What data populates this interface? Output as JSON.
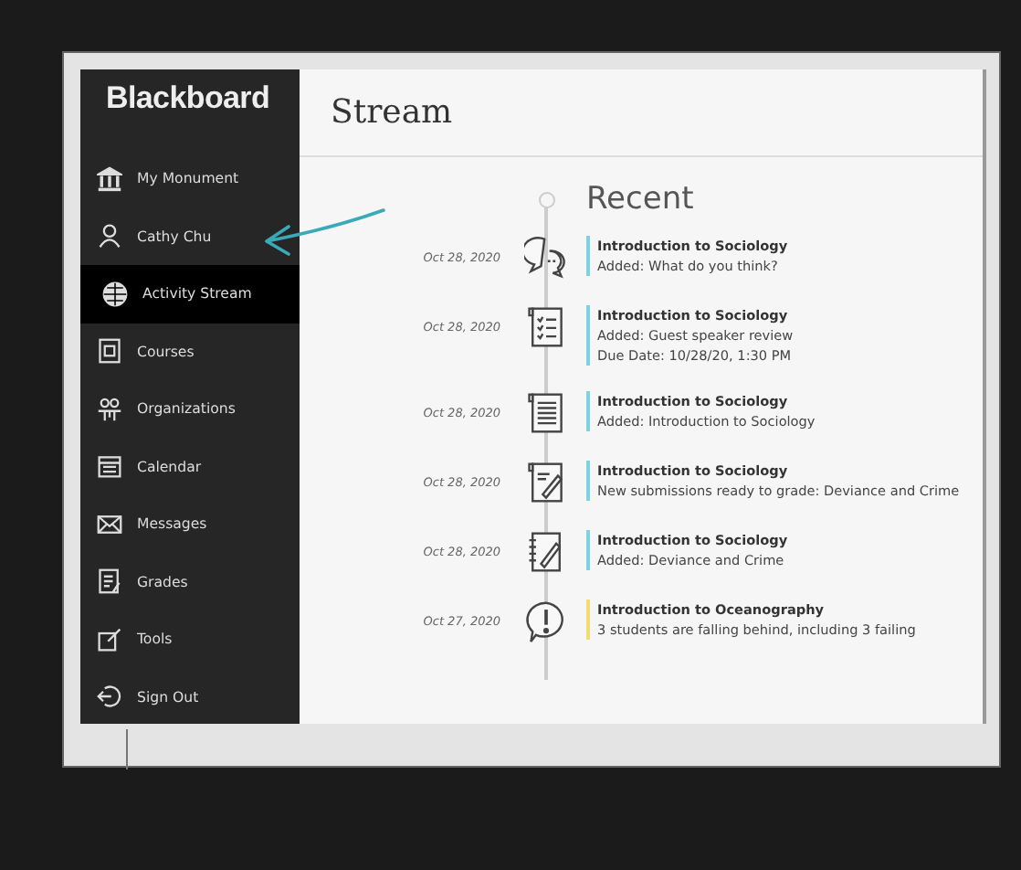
{
  "sidebar": {
    "logo": "Blackboard",
    "items": [
      {
        "label": "My Monument",
        "kind": "institution",
        "selected": false
      },
      {
        "label": "Cathy Chu",
        "kind": "person",
        "selected": false
      },
      {
        "label": "Activity Stream",
        "kind": "globe",
        "selected": true
      },
      {
        "label": "Courses",
        "kind": "courses",
        "selected": false
      },
      {
        "label": "Organizations",
        "kind": "people",
        "selected": false
      },
      {
        "label": "Calendar",
        "kind": "calendar",
        "selected": false
      },
      {
        "label": "Messages",
        "kind": "envelope",
        "selected": false
      },
      {
        "label": "Grades",
        "kind": "grades",
        "selected": false
      },
      {
        "label": "Tools",
        "kind": "tools",
        "selected": false
      },
      {
        "label": "Sign Out",
        "kind": "signout",
        "selected": false
      }
    ]
  },
  "page_title": "Stream",
  "section_title": "Recent",
  "stream": [
    {
      "date": "Oct 28, 2020",
      "kind": "discussion",
      "color": "#7dd3df",
      "course": "Introduction to Sociology",
      "lines": [
        "Added: What do you think?"
      ]
    },
    {
      "date": "Oct 28, 2020",
      "kind": "checklist",
      "color": "#7dd3df",
      "course": "Introduction to Sociology",
      "lines": [
        "Added: Guest speaker review",
        "Due Date: 10/28/20, 1:30 PM"
      ]
    },
    {
      "date": "Oct 28, 2020",
      "kind": "document",
      "color": "#7dd3df",
      "course": "Introduction to Sociology",
      "lines": [
        "Added: Introduction to Sociology"
      ]
    },
    {
      "date": "Oct 28, 2020",
      "kind": "grading",
      "color": "#7dd3df",
      "course": "Introduction to Sociology",
      "lines": [
        "New submissions ready to grade: Deviance and Crime"
      ]
    },
    {
      "date": "Oct 28, 2020",
      "kind": "notebook",
      "color": "#7dd3df",
      "course": "Introduction to Sociology",
      "lines": [
        "Added: Deviance and Crime"
      ]
    },
    {
      "date": "Oct 27, 2020",
      "kind": "alert",
      "color": "#f2dd72",
      "course": "Introduction to Oceanography",
      "lines": [
        "3 students are falling behind, including 3 failing"
      ]
    }
  ]
}
